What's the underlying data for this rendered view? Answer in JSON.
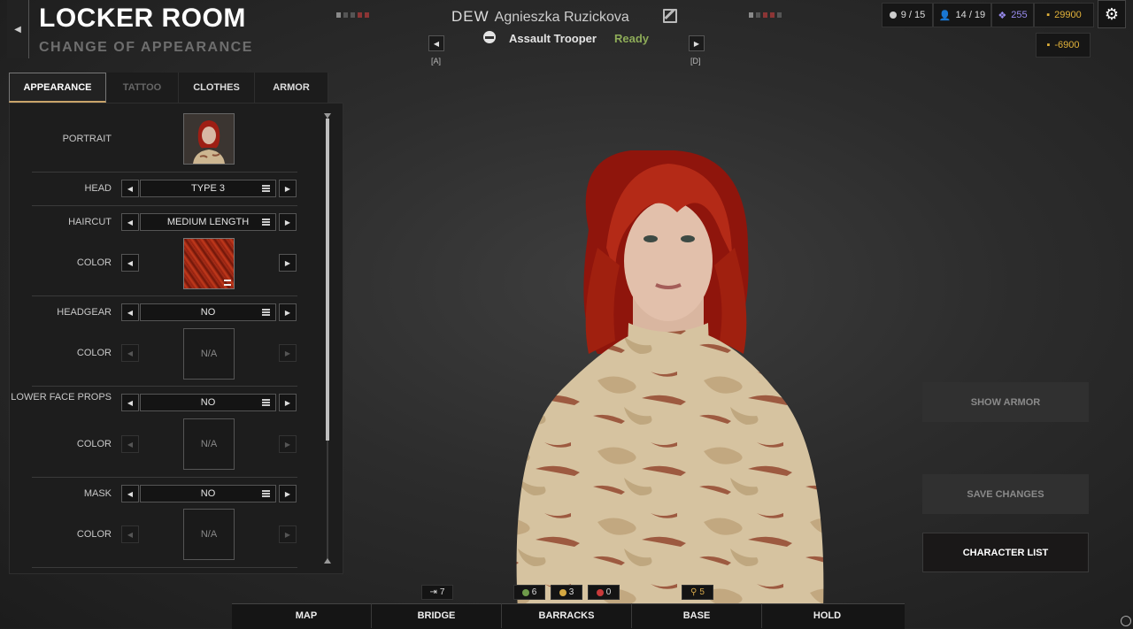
{
  "header": {
    "title": "LOCKER ROOM",
    "subtitle": "CHANGE OF APPEARANCE",
    "callsign": "DEW",
    "soldier_name": "Agnieszka Ruzickova",
    "soldier_class": "Assault Trooper",
    "soldier_status": "Ready",
    "prev_key": "[A]",
    "next_key": "[D]"
  },
  "resources": {
    "squad": "9 / 15",
    "soldiers": "14 / 19",
    "intel": "255",
    "credits": "29900",
    "cost": "-6900"
  },
  "tabs": [
    "APPEARANCE",
    "TATTOO",
    "CLOTHES",
    "ARMOR"
  ],
  "panel": {
    "portrait_label": "PORTRAIT",
    "head_label": "HEAD",
    "head_value": "TYPE 3",
    "haircut_label": "HAIRCUT",
    "haircut_value": "MEDIUM LENGTH",
    "color_label": "COLOR",
    "headgear_label": "HEADGEAR",
    "headgear_value": "NO",
    "lower_face_label": "LOWER FACE PROPS",
    "lower_face_value": "NO",
    "mask_label": "MASK",
    "mask_value": "NO",
    "na": "N/A"
  },
  "actions": {
    "show_armor": "SHOW ARMOR",
    "save_changes": "SAVE CHANGES",
    "character_list": "CHARACTER LIST"
  },
  "bottom_nav": [
    "MAP",
    "BRIDGE",
    "BARRACKS",
    "BASE",
    "HOLD"
  ],
  "bottom_counters": {
    "transport": "7",
    "green": "6",
    "yellow": "3",
    "red": "0",
    "slots": "5"
  },
  "colors": {
    "accent_gold": "#c9a46a",
    "ready_green": "#8dab58",
    "intel_purple": "#9a8cf0",
    "credits_yellow": "#e3b33a",
    "hair_red": "#b42a17"
  },
  "icons": [
    "back-arrow-icon",
    "edit-icon",
    "helmet-icon",
    "skull-icon",
    "person-icon",
    "intel-icon",
    "credits-icon",
    "gear-icon",
    "menu-icon",
    "chevron-left-icon",
    "chevron-right-icon"
  ]
}
